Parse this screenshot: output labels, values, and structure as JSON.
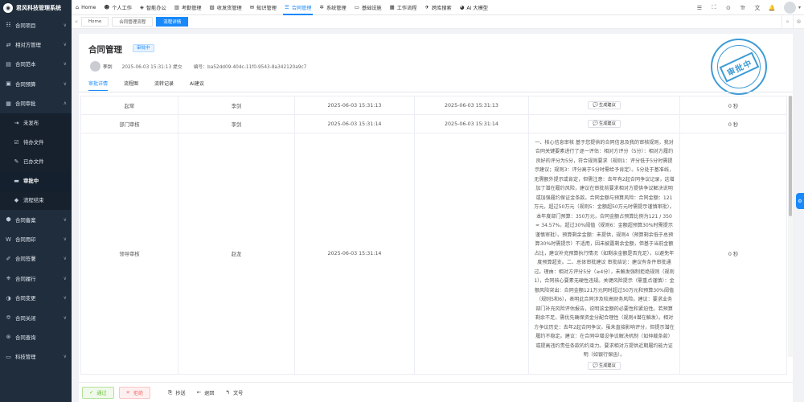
{
  "sidebar": {
    "logo_glyph": "◉",
    "title": "君风科技管理系统",
    "items": [
      {
        "icon": "☷",
        "label": "合同项目",
        "arrow": "∨"
      },
      {
        "icon": "⇄",
        "label": "相对方管理",
        "arrow": "∨"
      },
      {
        "icon": "▤",
        "label": "合同范本",
        "arrow": "∨"
      },
      {
        "icon": "▣",
        "label": "合同预算",
        "arrow": "∨"
      },
      {
        "icon": "▦",
        "label": "合同审批",
        "arrow": "∧"
      }
    ],
    "sub_items": [
      {
        "icon": "⇥",
        "label": "未发布"
      },
      {
        "icon": "☑",
        "label": "待办文件"
      },
      {
        "icon": "✎",
        "label": "已办文件"
      },
      {
        "icon": "▬",
        "label": "审批中"
      },
      {
        "icon": "◆",
        "label": "流程结束"
      }
    ],
    "items_after": [
      {
        "icon": "⬢",
        "label": "合同备案",
        "arrow": "∨"
      },
      {
        "icon": "W",
        "label": "合同用印",
        "arrow": "∨"
      },
      {
        "icon": "✐",
        "label": "合同签署",
        "arrow": "∨"
      },
      {
        "icon": "⎈",
        "label": "合同履行",
        "arrow": "∨"
      },
      {
        "icon": "◑",
        "label": "合同变更",
        "arrow": "∨"
      },
      {
        "icon": "⎊",
        "label": "合同关闭",
        "arrow": "∨"
      },
      {
        "icon": "⊛",
        "label": "合同查询",
        "arrow": ""
      },
      {
        "icon": "▭",
        "label": "科技管理",
        "arrow": "∨"
      }
    ]
  },
  "topnav": {
    "tabs": [
      {
        "icon": "⌂",
        "label": "Home"
      },
      {
        "icon": "☻",
        "label": "个人工作"
      },
      {
        "icon": "◈",
        "label": "智能办公"
      },
      {
        "icon": "▥",
        "label": "考勤管理"
      },
      {
        "icon": "▧",
        "label": "收发货管理"
      },
      {
        "icon": "✉",
        "label": "知识管理"
      },
      {
        "icon": "☰",
        "label": "合同管理"
      },
      {
        "icon": "✲",
        "label": "系统管理"
      },
      {
        "icon": "▭",
        "label": "基础设施"
      },
      {
        "icon": "▦",
        "label": "工作流程"
      },
      {
        "icon": "✈",
        "label": "跨库搜索"
      },
      {
        "icon": "◕",
        "label": "AI 大模型"
      }
    ],
    "tools": [
      "☰",
      "⛶",
      "⊙",
      "Tr",
      "文",
      "🔔"
    ]
  },
  "tagsbar": {
    "left_arrow": "«",
    "right_arrow": "»",
    "close": "⊗",
    "tags": [
      "Home",
      "合同管理流程",
      "流程详情"
    ]
  },
  "detail": {
    "title": "合同管理",
    "status": "审批中",
    "applicant": "李剑",
    "submitted": "2025-06-03 15:31:13 提交",
    "code": "编号：ba52dd09-404c-11f0-9543-8a342120a9c7",
    "stamp": "审批中",
    "subtabs": [
      "审批详情",
      "流程图",
      "流转记录",
      "Ai建议"
    ]
  },
  "table": {
    "suggest_label": "生成建议",
    "suggest_icon": "💬",
    "rows": [
      {
        "node": "起草",
        "person": "李剑",
        "start": "2025-06-03 15:31:13",
        "end": "2025-06-03 15:31:13",
        "duration": "0 秒"
      },
      {
        "node": "部门审核",
        "person": "李剑",
        "start": "2025-06-03 15:31:14",
        "end": "2025-06-03 15:31:14",
        "duration": "0 秒"
      },
      {
        "node": "领导审核",
        "person": "赵龙",
        "start": "2025-06-03 15:31:14",
        "end": "",
        "duration": "0 秒",
        "ai_text": "一、核心信息审核 基于您提供的合同信息及我的审核规则，我对合同关键要素进行了逐一评估：相对方评分（5分）：相对方履约良好的评分为5分，符合规则要求（规则1：评分低于5分时需提示建议；规则3：评分高于5分时需给予肯定）。5分处于基准线，无需额外提示或肯定，但需注意：去年有2起合同争议记录，这增加了潜在履约风险，建议在审批前要求相对方提供争议解决说明或加强履约保证金条款。合同金额与预算风险：合同金额：121万元，超过50万元（规则5：金额超50万元时需提示谨慎审批）。本年度部门预算：350万元，合同金额占预算比例为121 / 350 ≈ 34.57%，超过30%阈值（规则6：金额超预算30%时需提示谨慎审批）。预算剩余金额：未提供，规则4（预算剩余低于总预算30%时需提示）不适用，因未披露剩余金额，但基于当前金额占比，建议补充预算执行情况（如剩余金额是否充足），以避免年度预算超支。二、总体审批建议 审批结论：建议有条件审批通过。理由：相对方评分5分（≥4分），未触发强制拒绝规则（规则1），合同核心要素无硬性违规。关键风险提示（需重点谨慎）：金额风险突出：合同金额121万元同时超过50万元和预算30%阈值（规则5和6），表明此合同涉及较高财务风险。建议：要求业务部门补充风险评估报告，说明该金额的必要性和紧迫性。若预算剩余不足，需优先确保资金分配合理性（规则4潜在触发）。相对方争议历史：去年2起合同争议，虽未直接影响评分，但提示潜在履约不稳定。建议：在合同中增设争议解决机制（如仲裁条款）或提高违约责任条款的约束力。要求相对方提供近期履约能力证明（如银行保函）。"
      }
    ]
  },
  "footer": {
    "pass": "通过",
    "reject": "拒绝",
    "pass_icon": "✓",
    "reject_icon": "✕",
    "actions": [
      {
        "icon": "⎘",
        "label": "抄送"
      },
      {
        "icon": "←",
        "label": "退回"
      },
      {
        "icon": "↰",
        "label": "文号"
      }
    ]
  },
  "side_float_icon": "⚙"
}
